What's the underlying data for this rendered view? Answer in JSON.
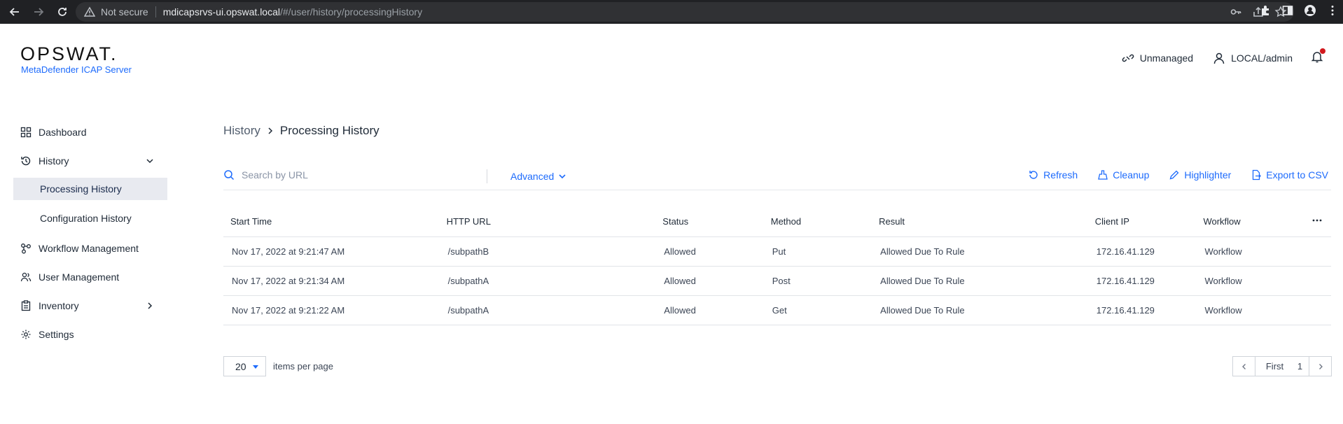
{
  "browser": {
    "security_label": "Not secure",
    "url_host": "mdicapsrvs-ui.opswat.local",
    "url_path": "/#/user/history/processingHistory"
  },
  "header": {
    "logo_text": "OPSWAT.",
    "product_name": "MetaDefender ICAP Server",
    "unmanaged_label": "Unmanaged",
    "user_label": "LOCAL/admin"
  },
  "sidebar": {
    "dashboard": "Dashboard",
    "history": "History",
    "processing_history": "Processing History",
    "configuration_history": "Configuration History",
    "workflow_management": "Workflow Management",
    "user_management": "User Management",
    "inventory": "Inventory",
    "settings": "Settings"
  },
  "breadcrumb": {
    "parent": "History",
    "current": "Processing History"
  },
  "toolbar": {
    "search_placeholder": "Search by URL",
    "advanced_label": "Advanced",
    "refresh_label": "Refresh",
    "cleanup_label": "Cleanup",
    "highlighter_label": "Highlighter",
    "export_label": "Export to CSV"
  },
  "table": {
    "headers": [
      "Start Time",
      "HTTP URL",
      "Status",
      "Method",
      "Result",
      "Client IP",
      "Workflow"
    ],
    "rows": [
      [
        "Nov 17, 2022 at 9:21:47 AM",
        "/subpathB",
        "Allowed",
        "Put",
        "Allowed Due To Rule",
        "172.16.41.129",
        "Workflow"
      ],
      [
        "Nov 17, 2022 at 9:21:34 AM",
        "/subpathA",
        "Allowed",
        "Post",
        "Allowed Due To Rule",
        "172.16.41.129",
        "Workflow"
      ],
      [
        "Nov 17, 2022 at 9:21:22 AM",
        "/subpathA",
        "Allowed",
        "Get",
        "Allowed Due To Rule",
        "172.16.41.129",
        "Workflow"
      ]
    ]
  },
  "pagination": {
    "per_page_value": "20",
    "per_page_label": "items per page",
    "first_label": "First",
    "current_page": "1"
  },
  "colors": {
    "accent": "#1d6bfc",
    "notification_dot": "#d1191e",
    "active_nav_bg": "#e8eaf0"
  }
}
